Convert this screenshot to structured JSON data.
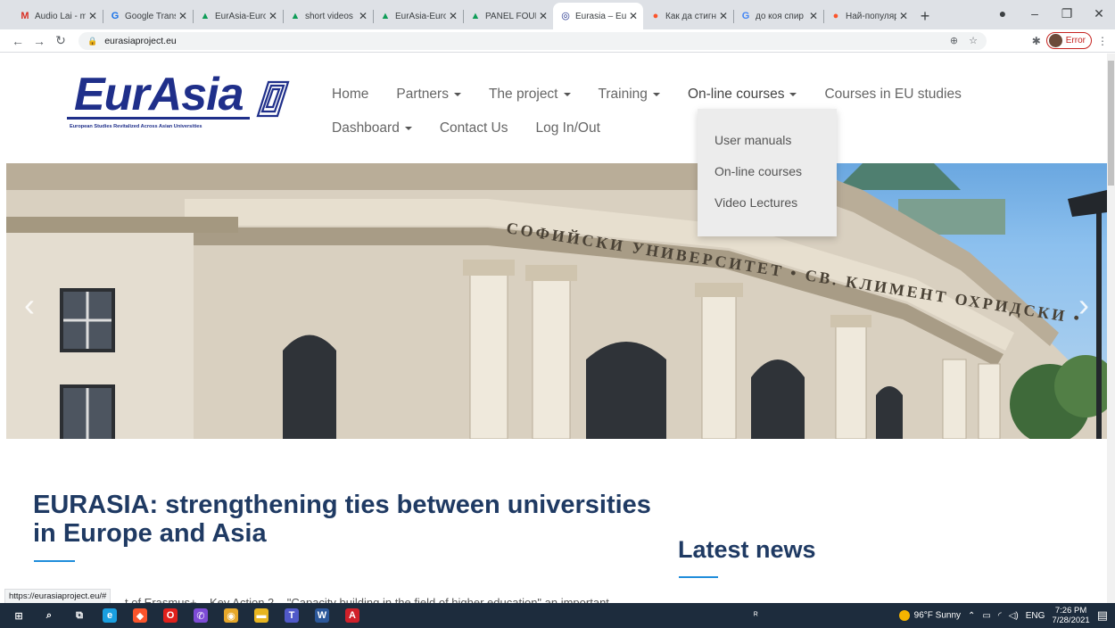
{
  "browser": {
    "tabs": [
      {
        "title": "Audio Lai - m",
        "icon": "gmail-icon",
        "color": "#d93025",
        "glyph": "M"
      },
      {
        "title": "Google Trans",
        "icon": "google-translate-icon",
        "color": "#1a73e8",
        "glyph": "G"
      },
      {
        "title": "EurAsia-Euro",
        "icon": "google-drive-icon",
        "color": "#0f9d58",
        "glyph": "▲"
      },
      {
        "title": "short videos",
        "icon": "google-drive-icon",
        "color": "#0f9d58",
        "glyph": "▲"
      },
      {
        "title": "EurAsia-Euro",
        "icon": "google-drive-icon",
        "color": "#0f9d58",
        "glyph": "▲"
      },
      {
        "title": "PANEL FOUR",
        "icon": "google-drive-icon",
        "color": "#0f9d58",
        "glyph": "▲"
      },
      {
        "title": "Eurasia – Eur",
        "icon": "eurasia-site-icon",
        "color": "#1f2f8a",
        "glyph": "◎",
        "active": true
      },
      {
        "title": "Как да стигн",
        "icon": "brave-icon",
        "color": "#fb542b",
        "glyph": "●"
      },
      {
        "title": "до коя спир",
        "icon": "google-icon",
        "color": "#4285f4",
        "glyph": "G"
      },
      {
        "title": "Най-популяр",
        "icon": "brave-icon",
        "color": "#fb542b",
        "glyph": "●"
      }
    ],
    "new_tab": "+",
    "url": "eurasiaproject.eu",
    "profile_status": "Error"
  },
  "site": {
    "logo_text": "EurAsia",
    "logo_tagline": "European Studies Revitalized Across Asian Universities",
    "nav_row1": [
      {
        "label": "Home",
        "caret": false
      },
      {
        "label": "Partners",
        "caret": true
      },
      {
        "label": "The project",
        "caret": true
      },
      {
        "label": "Training",
        "caret": true
      },
      {
        "label": "On-line courses",
        "caret": true
      },
      {
        "label": "Courses in EU studies",
        "caret": false
      }
    ],
    "nav_row2": [
      {
        "label": "Dashboard",
        "caret": true
      },
      {
        "label": "Contact Us",
        "caret": false
      },
      {
        "label": "Log In/Out",
        "caret": false
      }
    ],
    "dropdown": [
      "User manuals",
      "On-line courses",
      "Video Lectures"
    ],
    "hero_inscription": "СОФИЙСКИ УНИВЕРСИТЕТ • СВ. КЛИМЕНТ ОХРИДСКИ •",
    "hero_prev": "‹",
    "hero_next": "›",
    "headline": "EURASIA: strengthening ties between universities in Europe and Asia",
    "news_heading": "Latest news",
    "body_snippet": "t of Erasmus+ – Key Action 2 – \"Capacity building in the field of higher education\" an important",
    "status_url": "https://eurasiaproject.eu/#"
  },
  "taskbar": {
    "icons": [
      {
        "name": "windows-start-icon",
        "color": "#1d2c3d",
        "glyph": "⊞"
      },
      {
        "name": "search-icon",
        "color": "#1d2c3d",
        "glyph": "⌕"
      },
      {
        "name": "task-view-icon",
        "color": "#1d2c3d",
        "glyph": "⧉"
      },
      {
        "name": "edge-icon",
        "color": "#1a9fe0",
        "glyph": "e"
      },
      {
        "name": "brave-browser-icon",
        "color": "#fb542b",
        "glyph": "◆"
      },
      {
        "name": "opera-icon",
        "color": "#e0201b",
        "glyph": "O"
      },
      {
        "name": "viber-icon",
        "color": "#7d4bd6",
        "glyph": "✆"
      },
      {
        "name": "chrome-icon",
        "color": "#e6a72a",
        "glyph": "◉"
      },
      {
        "name": "file-explorer-icon",
        "color": "#e8b520",
        "glyph": "▬"
      },
      {
        "name": "teams-icon",
        "color": "#5059c9",
        "glyph": "T"
      },
      {
        "name": "word-icon",
        "color": "#2b579a",
        "glyph": "W"
      },
      {
        "name": "acrobat-icon",
        "color": "#d0202a",
        "glyph": "A"
      }
    ],
    "weather": "96°F Sunny",
    "language": "ENG",
    "time": "7:26 PM",
    "date": "7/28/2021"
  }
}
